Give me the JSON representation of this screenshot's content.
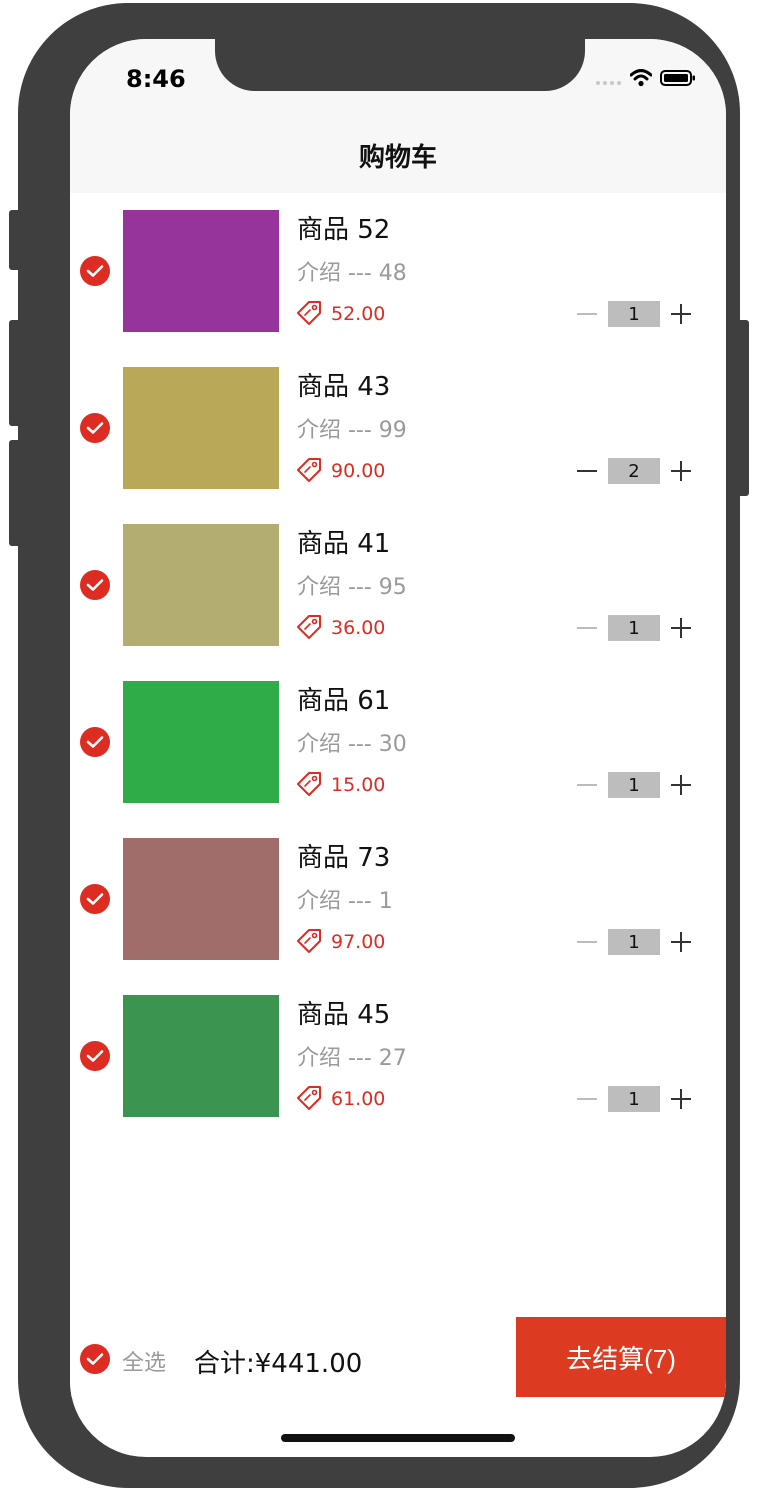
{
  "status_bar": {
    "time": "8:46"
  },
  "nav": {
    "title": "购物车"
  },
  "items": [
    {
      "name": "商品 52",
      "desc": "介绍 --- 48",
      "price": "52.00",
      "qty": "1",
      "color": "#96349c",
      "minus_enabled": false
    },
    {
      "name": "商品 43",
      "desc": "介绍 --- 99",
      "price": "90.00",
      "qty": "2",
      "color": "#b9a857",
      "minus_enabled": true
    },
    {
      "name": "商品 41",
      "desc": "介绍 --- 95",
      "price": "36.00",
      "qty": "1",
      "color": "#b4ad72",
      "minus_enabled": false
    },
    {
      "name": "商品 61",
      "desc": "介绍 --- 30",
      "price": "15.00",
      "qty": "1",
      "color": "#2fac47",
      "minus_enabled": false
    },
    {
      "name": "商品 73",
      "desc": "介绍 --- 1",
      "price": "97.00",
      "qty": "1",
      "color": "#a06d6b",
      "minus_enabled": false
    },
    {
      "name": "商品 45",
      "desc": "介绍 --- 27",
      "price": "61.00",
      "qty": "1",
      "color": "#3b9550",
      "minus_enabled": false
    }
  ],
  "footer": {
    "select_all_label": "全选",
    "total": "合计:¥441.00",
    "checkout_label": "去结算(7)"
  },
  "colors": {
    "accent": "#dd2c22",
    "checkout": "#dd3a22"
  },
  "icons": {
    "check": "check-circle-icon",
    "price_tag": "price-tag-icon",
    "minus": "minus-icon",
    "plus": "plus-icon"
  }
}
